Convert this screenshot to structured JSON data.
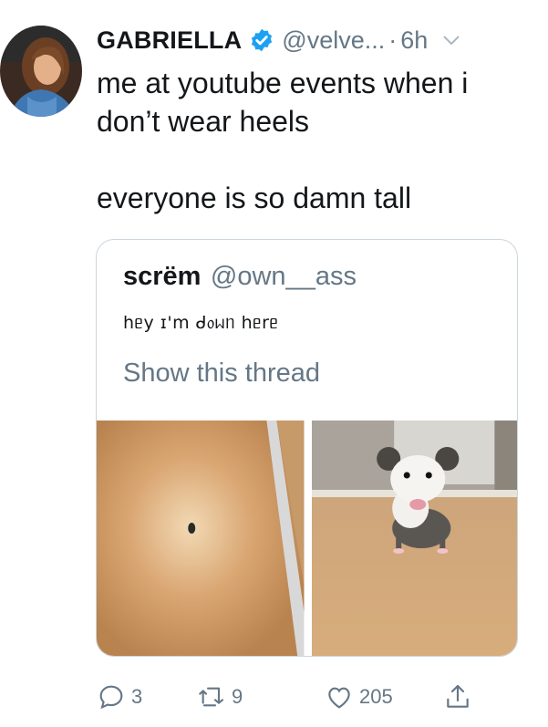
{
  "tweet": {
    "display_name": "GABRIELLA",
    "handle": "@velve...",
    "separator": "·",
    "time": "6h",
    "text_line1": "me at youtube events when i don’t wear heels",
    "text_line2": "everyone is so damn tall"
  },
  "quoted": {
    "display_name": "scrëm",
    "handle": "@own__ass",
    "text": "hᥱy ɪ'm ᑯ᥆ᥕᥒ hᥱrᥱ",
    "thread_link": "Show this thread"
  },
  "actions": {
    "replies": "3",
    "retweets": "9",
    "likes": "205"
  },
  "colors": {
    "verified": "#1da1f2",
    "secondary_text": "#657786",
    "border": "#ccd6dd"
  }
}
